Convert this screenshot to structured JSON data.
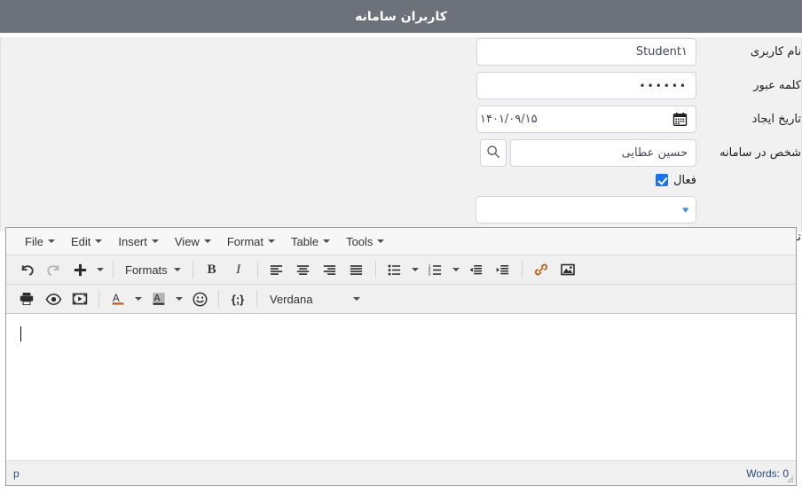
{
  "window": {
    "title": "کاربران سامانه",
    "titlebar_bg": "#6c717a",
    "titlebar_fg": "#ffffff"
  },
  "form": {
    "fields": [
      {
        "label": "نام کاربری",
        "value": "Student۱",
        "type": "text"
      },
      {
        "label": "کلمه عبور",
        "value": "••••••",
        "type": "password"
      },
      {
        "label": "تاریخ ایجاد",
        "value": "۱۴۰۱/۰۹/۱۵",
        "type": "date",
        "icon": "calendar-icon"
      },
      {
        "label": "شخص در سامانه",
        "value": "حسین عطایی",
        "type": "lookup",
        "icon": "search-icon"
      }
    ],
    "active_checkbox": {
      "label": "فعال",
      "checked": true,
      "accent": "#1a73e8"
    },
    "descriptions": {
      "label": "توضیحات",
      "selected": "",
      "chevron": "chevron-down-icon",
      "chevron_color": "#3b8ede"
    }
  },
  "editor": {
    "menubar": [
      {
        "label": "File"
      },
      {
        "label": "Edit"
      },
      {
        "label": "Insert"
      },
      {
        "label": "View"
      },
      {
        "label": "Format"
      },
      {
        "label": "Table"
      },
      {
        "label": "Tools"
      }
    ],
    "toolbar_row1": [
      {
        "name": "undo-icon",
        "title": "Undo",
        "disabled": false
      },
      {
        "name": "redo-icon",
        "title": "Redo",
        "disabled": true
      },
      {
        "name": "insert-plus-icon",
        "title": "Insert",
        "disabled": false
      },
      {
        "name": "formats-dropdown",
        "title": "Formats",
        "disabled": false
      },
      {
        "name": "bold-icon",
        "title": "Bold",
        "disabled": false
      },
      {
        "name": "italic-icon",
        "title": "Italic",
        "disabled": false
      },
      {
        "name": "align-left-icon",
        "title": "Align left",
        "disabled": false
      },
      {
        "name": "align-center-icon",
        "title": "Align center",
        "disabled": false
      },
      {
        "name": "align-right-icon",
        "title": "Align right",
        "disabled": false
      },
      {
        "name": "align-justify-icon",
        "title": "Justify",
        "disabled": false
      },
      {
        "name": "bullet-list-icon",
        "title": "Bullet list",
        "disabled": false
      },
      {
        "name": "numbered-list-icon",
        "title": "Numbered list",
        "disabled": false
      },
      {
        "name": "outdent-icon",
        "title": "Decrease indent",
        "disabled": false
      },
      {
        "name": "indent-icon",
        "title": "Increase indent",
        "disabled": false
      },
      {
        "name": "link-icon",
        "title": "Insert link",
        "disabled": false
      },
      {
        "name": "image-icon",
        "title": "Insert image",
        "disabled": false
      }
    ],
    "toolbar_row2": [
      {
        "name": "print-icon",
        "title": "Print"
      },
      {
        "name": "preview-icon",
        "title": "Preview"
      },
      {
        "name": "media-icon",
        "title": "Insert media"
      },
      {
        "name": "text-color-icon",
        "title": "Text color"
      },
      {
        "name": "background-color-icon",
        "title": "Background color"
      },
      {
        "name": "emoticon-icon",
        "title": "Emoticons"
      },
      {
        "name": "source-code-icon",
        "title": "Source code"
      }
    ],
    "formats_label": "Formats",
    "font_family": "Verdana",
    "content": "",
    "status": {
      "path": "p",
      "words": "Words: 0"
    }
  }
}
